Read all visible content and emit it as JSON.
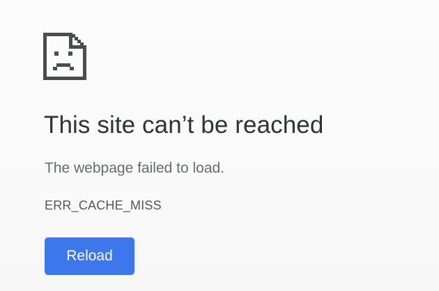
{
  "error": {
    "icon": "sad-page-icon",
    "title": "This site can’t be reached",
    "message": "The webpage failed to load.",
    "code": "ERR_CACHE_MISS"
  },
  "actions": {
    "reload_label": "Reload"
  },
  "colors": {
    "button": "#3d77ec",
    "title": "#303234",
    "message": "#686a6d",
    "icon": "#4a4c50"
  }
}
